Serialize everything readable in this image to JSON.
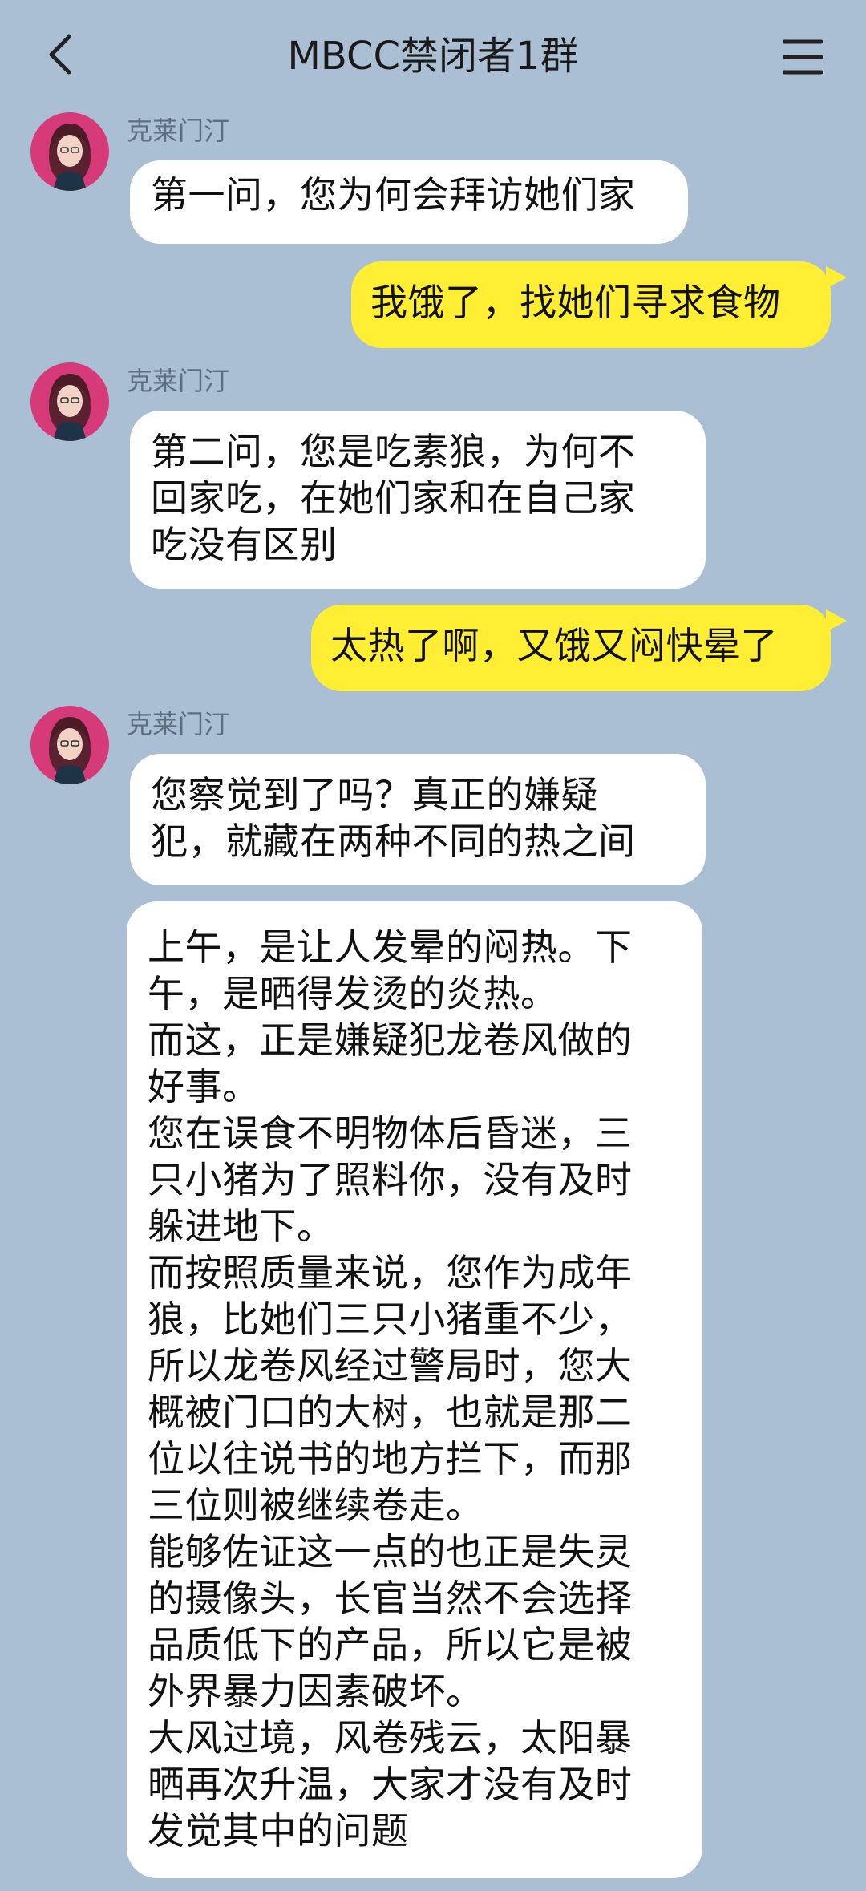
{
  "header": {
    "title": "MBCC禁闭者1群",
    "back_icon": "chevron-left-icon",
    "menu_icon": "hamburger-menu-icon"
  },
  "colors": {
    "background": "#aabfd3",
    "incoming_bubble": "#ffffff",
    "outgoing_bubble": "#ffee33",
    "sender_name": "#5d6e80"
  },
  "messages": [
    {
      "direction": "in",
      "sender": "克莱门汀",
      "text": "第一问，您为何会拜访她们家"
    },
    {
      "direction": "out",
      "text": "我饿了，找她们寻求食物"
    },
    {
      "direction": "in",
      "sender": "克莱门汀",
      "text": "第二问，您是吃素狼，为何不\n回家吃，在她们家和在自己家\n吃没有区别"
    },
    {
      "direction": "out",
      "text": "太热了啊，又饿又闷快晕了"
    },
    {
      "direction": "in",
      "sender": "克莱门汀",
      "text": "您察觉到了吗？真正的嫌疑\n犯，就藏在两种不同的热之间"
    },
    {
      "direction": "in",
      "text": "上午，是让人发晕的闷热。下\n午，是晒得发烫的炎热。\n而这，正是嫌疑犯龙卷风做的\n好事。\n您在误食不明物体后昏迷，三\n只小猪为了照料你，没有及时\n躲进地下。\n而按照质量来说，您作为成年\n狼，比她们三只小猪重不少，\n所以龙卷风经过警局时，您大\n概被门口的大树，也就是那二\n位以往说书的地方拦下，而那\n三位则被继续卷走。\n能够佐证这一点的也正是失灵\n的摄像头，长官当然不会选择\n品质低下的产品，所以它是被\n外界暴力因素破坏。\n大风过境，风卷残云，太阳暴\n晒再次升温，大家才没有及时\n发觉其中的问题"
    }
  ]
}
